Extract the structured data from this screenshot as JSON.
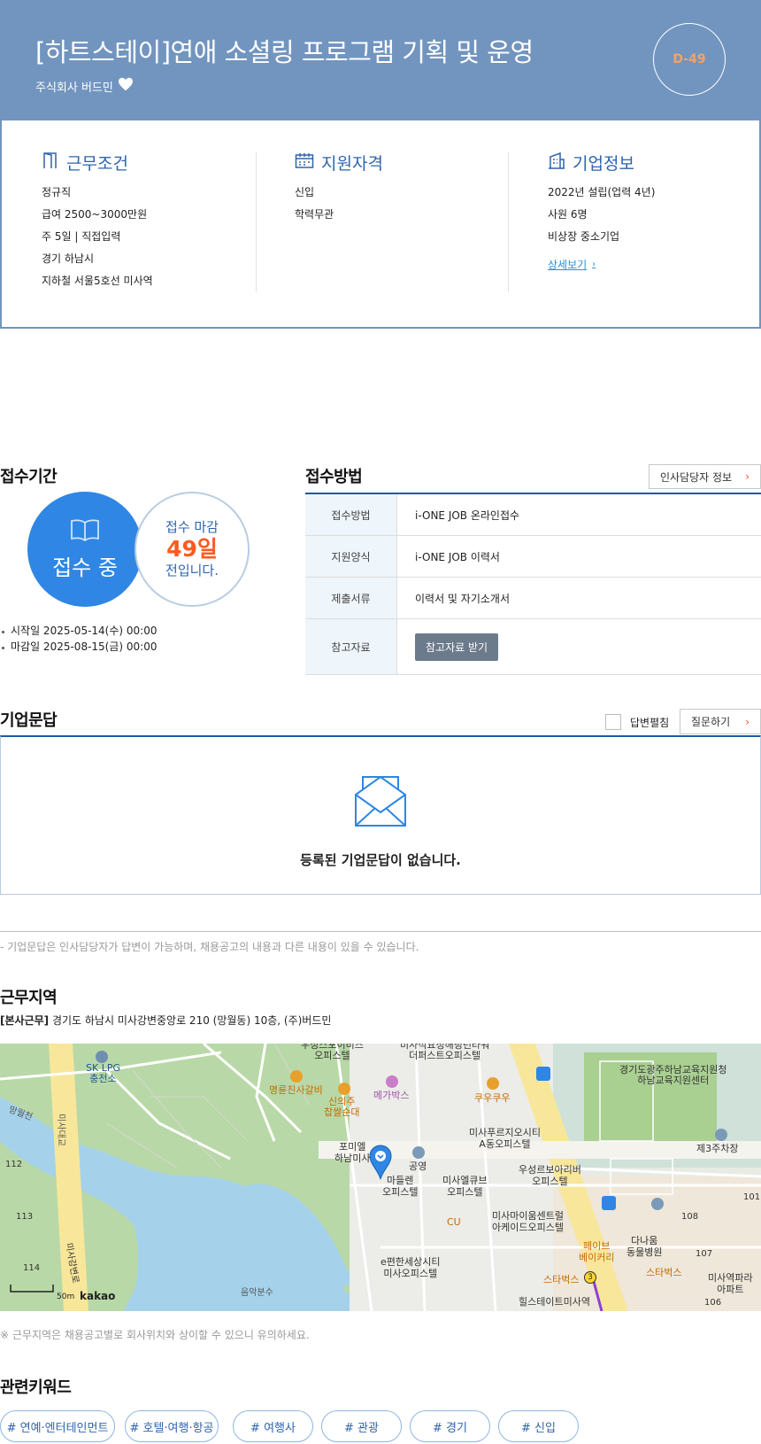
{
  "header": {
    "title": "[하트스테이]연애 소셜링 프로그램 기획 및 운영",
    "company": "주식회사 버드민",
    "dday": "D-49",
    "colors": {
      "header_bg": "#7295bf",
      "dday_text": "#f4a367",
      "accent_blue": "#2f64ad"
    }
  },
  "summary": {
    "work": {
      "title": "근무조건",
      "icon": "flag-icon",
      "lines": [
        "정규직",
        "급여 2500~3000만원",
        "주 5일 | 직접입력",
        "경기 하남시",
        "지하철 서울5호선 미사역"
      ]
    },
    "qualification": {
      "title": "지원자격",
      "icon": "calendar-icon",
      "lines": [
        "신입",
        "학력무관"
      ]
    },
    "company": {
      "title": "기업정보",
      "icon": "building-icon",
      "lines": [
        "2022년 설립(업력 4년)",
        "사원 6명",
        "비상장 중소기업"
      ],
      "detail_link": "상세보기"
    }
  },
  "period": {
    "title": "접수기간",
    "status": "접수 중",
    "deadline_top": "접수 마감",
    "deadline_days": "49일",
    "deadline_bottom": "전입니다.",
    "start": "시작일 2025-05-14(수) 00:00",
    "end": "마감일 2025-08-15(금) 00:00"
  },
  "method": {
    "title": "접수방법",
    "hr_button": "인사담당자 정보",
    "rows": [
      {
        "label": "접수방법",
        "value": "i-ONE JOB 온라인접수"
      },
      {
        "label": "지원양식",
        "value": "i-ONE JOB 이력서"
      },
      {
        "label": "제출서류",
        "value": "이력서 및 자기소개서"
      },
      {
        "label": "참고자료",
        "button": "참고자료 받기"
      }
    ]
  },
  "qa": {
    "title": "기업문답",
    "expand_label": "답변펼침",
    "ask_button": "질문하기",
    "empty": "등록된 기업문답이 없습니다.",
    "note": "- 기업문답은 인사담당자가 답변이 가능하며, 채용공고의 내용과 다른 내용이 있을 수 있습니다."
  },
  "location": {
    "title": "근무지역",
    "tag": "[본사근무]",
    "address": "경기도 하남시 미사강변중앙로 210 (망월동) 10층, (주)버드민",
    "note": "※ 근무지역은 채용공고별로 회사위치와 상이할 수 있으니 유의하세요.",
    "map": {
      "scale": "50m",
      "brand": "kakao",
      "labels": {
        "sk_lpg": "SK LPG",
        "sk_lpg2": "충전소",
        "office_top1": "우성스포이비즈",
        "office_top2": "오피스텔",
        "misa_top1": "미사석요정해링턴타워",
        "misa_top2": "더퍼스트오피스텔",
        "gov1": "경기도광주하남교육지원청",
        "gov2": "하남교육지원센터",
        "myeongryun": "명륜진사갈비",
        "sinuiju1": "신의주",
        "sinuiju2": "찹쌀순대",
        "megabox": "메가박스",
        "quwoo": "쿠우쿠우",
        "mangwol": "망월천",
        "misacheon": "미사대교",
        "formie1": "포미엘",
        "formie2": "하남미사",
        "gongyeong": "공영",
        "purgio1": "미사푸르지오시티",
        "purgio2": "A동오피스텔",
        "parking3": "제3주차장",
        "madeleine1": "마들렌",
        "madeleine2": "오피스텔",
        "mielcube1": "미사엘큐브",
        "mielcube2": "오피스텔",
        "river1": "우성르보아리버",
        "river2": "오피스텔",
        "n112": "112",
        "n113": "113",
        "n114": "114",
        "n101": "101",
        "n108": "108",
        "n107": "107",
        "n106": "106",
        "cu": "CU",
        "myeongsang1": "미사마이움센트럴",
        "myeongsang2": "아케이드오피스텔",
        "bakery1": "페이브",
        "bakery2": "베이커리",
        "danaum1": "다나움",
        "danaum2": "동물병원",
        "starbucks1": "스타벅스",
        "starbucks2": "스타벅스",
        "epyeon1": "e편한세상시티",
        "epyeon2": "미사오피스텔",
        "hillstate": "힐스테이트미사역",
        "misastation1": "미사역파라",
        "misastation2": "아파트",
        "road": "미사강변로",
        "music": "음악분수",
        "exit3": "3"
      }
    }
  },
  "keywords": {
    "title": "관련키워드",
    "items": [
      "# 연예·엔터테인먼트",
      "# 호텔·여행·항공",
      "# 여행사",
      "# 관광",
      "# 경기",
      "# 신입"
    ]
  }
}
